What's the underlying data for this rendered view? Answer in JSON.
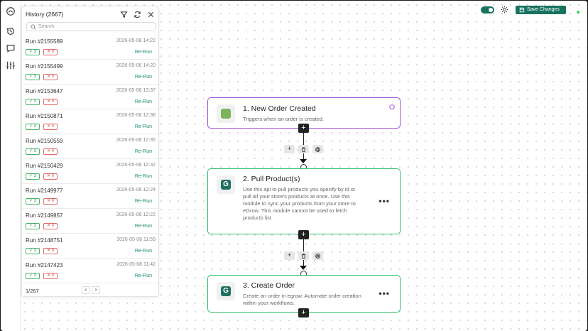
{
  "sidebar": {
    "icons": [
      "home-icon",
      "history-icon",
      "chat-icon",
      "sliders-icon"
    ]
  },
  "history": {
    "title": "History (2667)",
    "search_placeholder": "Search",
    "rerun_label": "Re-Run",
    "runs": [
      {
        "id": "Run #2155589",
        "date": "2026-05-08 14:22",
        "ok": "✓ 3",
        "fail": "✕ 0"
      },
      {
        "id": "Run #2155499",
        "date": "2026-05-08 14:20",
        "ok": "✓ 3",
        "fail": "✕ 0"
      },
      {
        "id": "Run #2153647",
        "date": "2026-05-08 13:37",
        "ok": "✓ 3",
        "fail": "✕ 0"
      },
      {
        "id": "Run #2150871",
        "date": "2026-05-08 12:38",
        "ok": "✓ 3",
        "fail": "✕ 0"
      },
      {
        "id": "Run #2150559",
        "date": "2026-05-08 12:35",
        "ok": "✓ 3",
        "fail": "✕ 0"
      },
      {
        "id": "Run #2150429",
        "date": "2026-05-08 12:32",
        "ok": "✓ 3",
        "fail": "✕ 0"
      },
      {
        "id": "Run #2149977",
        "date": "2026-05-08 12:24",
        "ok": "✓ 3",
        "fail": "✕ 0"
      },
      {
        "id": "Run #2149857",
        "date": "2026-05-08 12:22",
        "ok": "✓ 3",
        "fail": "✕ 0"
      },
      {
        "id": "Run #2148751",
        "date": "2026-05-08 11:59",
        "ok": "✓ 3",
        "fail": "✕ 0"
      },
      {
        "id": "Run #2147423",
        "date": "2026-05-08 11:42",
        "ok": "✓ 3",
        "fail": "✕ 0"
      }
    ],
    "page": "1/267",
    "prev": "‹",
    "next": "›"
  },
  "toolbar": {
    "save_label": "Save Changes",
    "toggle_on": true
  },
  "flow": {
    "steps": [
      {
        "title": "1. New Order Created",
        "desc": "Triggers when an order is created.",
        "border_color": "#a64fd6",
        "icon": "shopify-icon",
        "icon_color": "#7ab55c"
      },
      {
        "title": "2. Pull Product(s)",
        "desc": "Use this api to pull products you specify by id or pull all your store's products at once. Use this module to sync your products from your store to eGrow. This module cannot be used to fetch products list.",
        "border_color": "#2fbf6a",
        "icon": "egrow-icon",
        "icon_color": "#1f6f63"
      },
      {
        "title": "3. Create Order",
        "desc": "Create an order in egrow. Automate order creation within your workflows.",
        "border_color": "#2fbf6a",
        "icon": "egrow-icon",
        "icon_color": "#1f6f63"
      }
    ],
    "add_label": "+",
    "more_label": "•••"
  },
  "colors": {
    "accent": "#17725f",
    "success": "#2e9a52",
    "danger": "#d24a4a"
  }
}
